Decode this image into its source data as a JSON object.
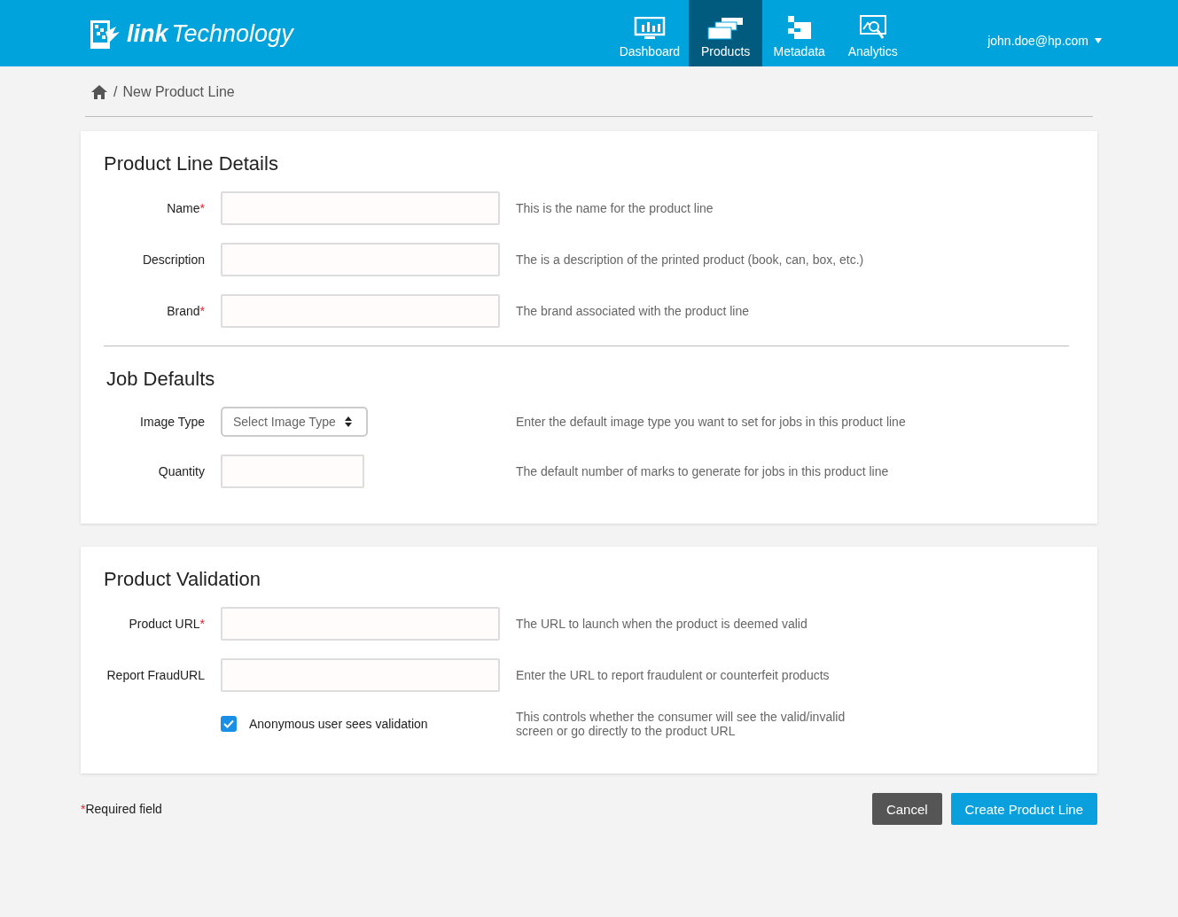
{
  "header": {
    "logo": {
      "bold": "link",
      "light": "Technology"
    },
    "nav": [
      {
        "kind": "dashboard",
        "label": "Dashboard",
        "selected": false
      },
      {
        "kind": "products",
        "label": "Products",
        "selected": true
      },
      {
        "kind": "metadata",
        "label": "Metadata",
        "selected": false
      },
      {
        "kind": "analytics",
        "label": "Analytics",
        "selected": false
      }
    ],
    "user": "john.doe@hp.com"
  },
  "breadcrumb": {
    "separator": "/",
    "current": "New Product Line"
  },
  "required_mark": "*",
  "cards": [
    {
      "sections": [
        {
          "title": "Product Line Details",
          "fields": [
            {
              "kind": "text",
              "label": "Name",
              "required": true,
              "help": "This is the name for the product line"
            },
            {
              "kind": "text",
              "label": "Description",
              "required": false,
              "help": "The is a description of the printed product (book, can, box, etc.)"
            },
            {
              "kind": "text",
              "label": "Brand",
              "required": true,
              "help": "The brand associated with the product line"
            }
          ]
        },
        {
          "title": "Job Defaults",
          "fields": [
            {
              "kind": "select",
              "label": "Image Type",
              "required": false,
              "placeholder": "Select Image Type",
              "help": "Enter the default image type you want to set for jobs in this product line"
            },
            {
              "kind": "short",
              "label": "Quantity",
              "required": false,
              "help": "The default number of marks to generate for jobs in this product line"
            }
          ]
        }
      ]
    },
    {
      "sections": [
        {
          "title": "Product Validation",
          "fields": [
            {
              "kind": "text",
              "label": "Product URL",
              "required": true,
              "help": "The URL to launch when the product is deemed valid"
            },
            {
              "kind": "text",
              "label": "Report FraudURL",
              "required": false,
              "help": "Enter the URL to report fraudulent  or counterfeit products"
            },
            {
              "kind": "checkbox",
              "label": "Anonymous user sees validation",
              "checked": true,
              "help": "This controls whether the consumer will see the valid/invalid screen or go directly to the product URL"
            }
          ]
        }
      ]
    }
  ],
  "footer": {
    "note": "Required field",
    "buttons": [
      {
        "kind": "secondary",
        "label": "Cancel"
      },
      {
        "kind": "primary",
        "label": "Create Product Line"
      }
    ]
  }
}
